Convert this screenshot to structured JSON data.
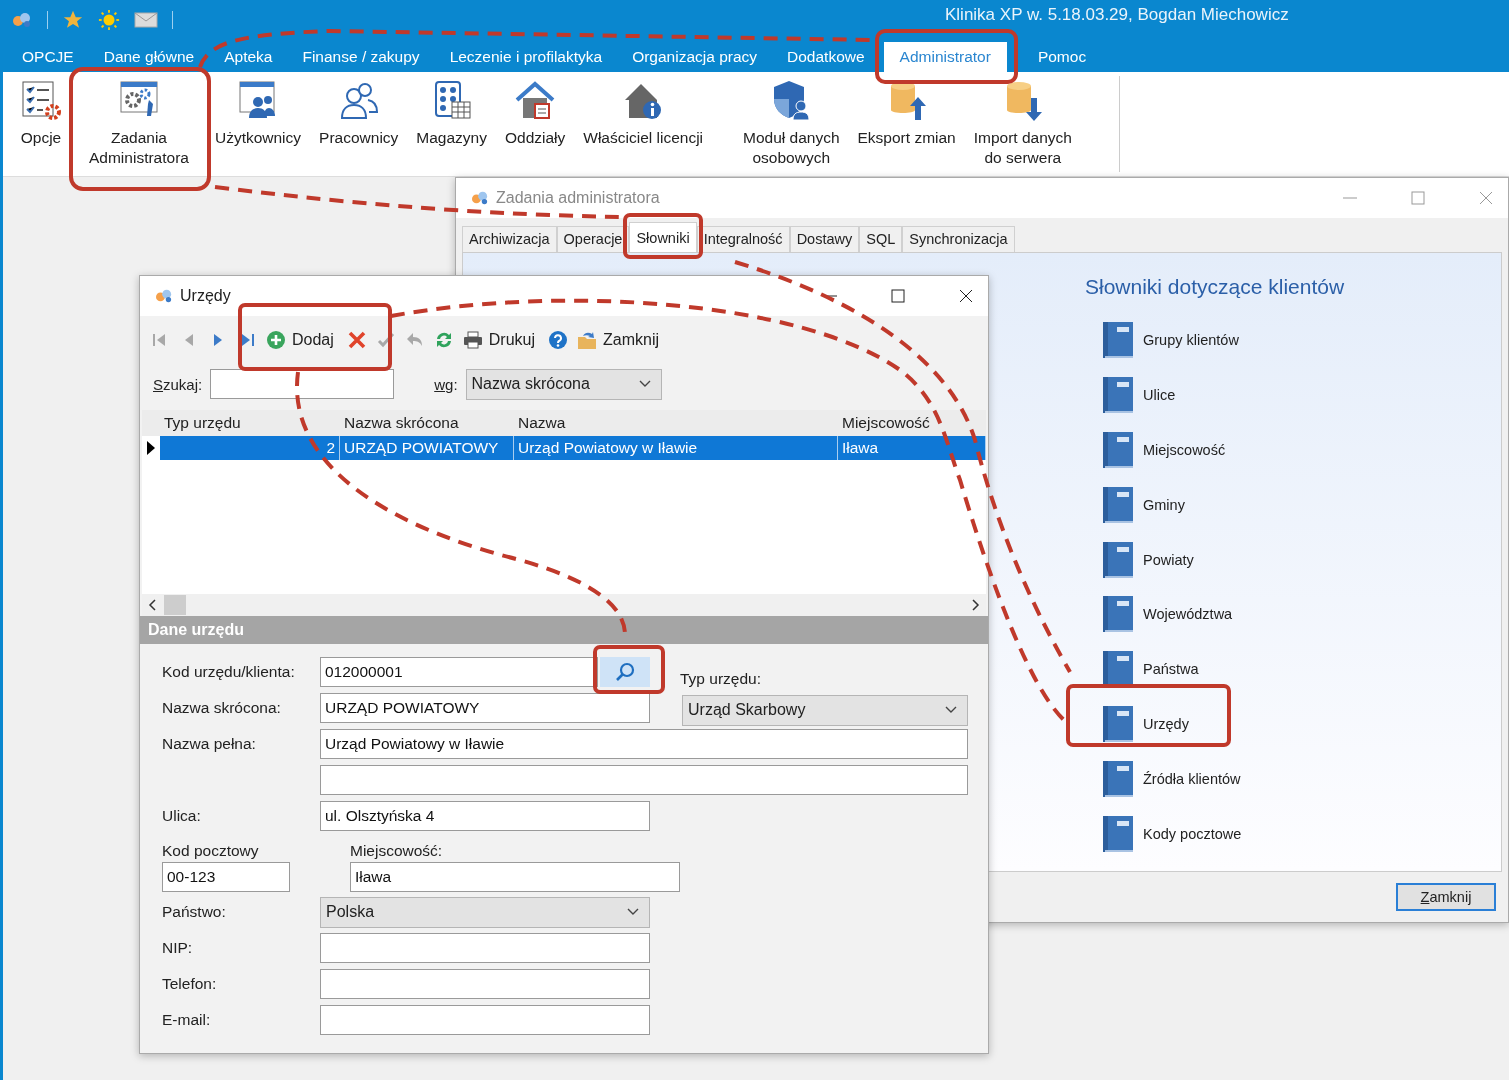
{
  "app": {
    "title": "Klinika XP w. 5.18.03.29, Bogdan Miechowicz",
    "menu": [
      {
        "label": "OPCJE",
        "selected": false
      },
      {
        "label": "Dane główne",
        "selected": false
      },
      {
        "label": "Apteka",
        "selected": false
      },
      {
        "label": "Finanse / zakupy",
        "selected": false
      },
      {
        "label": "Leczenie i profilaktyka",
        "selected": false
      },
      {
        "label": "Organizacja pracy",
        "selected": false
      },
      {
        "label": "Dodatkowe",
        "selected": false
      },
      {
        "label": "Administrator",
        "selected": true
      },
      {
        "label": "Pomoc",
        "selected": false
      }
    ],
    "ribbon": [
      {
        "lines": [
          "Opcje"
        ]
      },
      {
        "lines": [
          "Zadania",
          "Administratora"
        ]
      },
      {
        "lines": [
          "Użytkownicy"
        ]
      },
      {
        "lines": [
          "Pracownicy"
        ]
      },
      {
        "lines": [
          "Magazyny"
        ]
      },
      {
        "lines": [
          "Oddziały"
        ]
      },
      {
        "lines": [
          "Właściciel licencji"
        ]
      },
      {
        "lines": [
          "Moduł danych",
          "osobowych"
        ]
      },
      {
        "lines": [
          "Eksport zmian"
        ]
      },
      {
        "lines": [
          "Import danych",
          "do serwera"
        ]
      }
    ]
  },
  "tasks_window": {
    "title": "Zadania administratora",
    "tabs": [
      {
        "label": "Archiwizacja",
        "selected": false
      },
      {
        "label": "Operacje",
        "selected": false
      },
      {
        "label": "Słowniki",
        "selected": true
      },
      {
        "label": "Integralność",
        "selected": false
      },
      {
        "label": "Dostawy",
        "selected": false
      },
      {
        "label": "SQL",
        "selected": false
      },
      {
        "label": "Synchronizacja",
        "selected": false
      }
    ],
    "heading": "Słowniki dotyczące klientów",
    "items": [
      "Grupy klientów",
      "Ulice",
      "Miejscowość",
      "Gminy",
      "Powiaty",
      "Województwa",
      "Państwa",
      "Urzędy",
      "Źródła klientów",
      "Kody pocztowe"
    ],
    "close_button": "Zamknij"
  },
  "offices_window": {
    "title": "Urzędy",
    "toolbar": [
      {
        "kind": "first",
        "disabled": true
      },
      {
        "kind": "prev",
        "disabled": true
      },
      {
        "kind": "next",
        "disabled": false
      },
      {
        "kind": "last",
        "disabled": false
      },
      {
        "kind": "add",
        "label": "Dodaj",
        "disabled": false
      },
      {
        "kind": "delete",
        "disabled": false
      },
      {
        "kind": "confirm",
        "disabled": true
      },
      {
        "kind": "undo",
        "disabled": true
      },
      {
        "kind": "refresh",
        "disabled": false
      },
      {
        "kind": "print",
        "label": "Drukuj",
        "disabled": false
      },
      {
        "kind": "help",
        "disabled": false
      },
      {
        "kind": "close",
        "label": "Zamknij",
        "disabled": false
      }
    ],
    "search": {
      "label": "Szukaj:"
    },
    "sort": {
      "label": "wg:",
      "value": "Nazwa skrócona"
    },
    "table": {
      "columns": [
        "Typ urzędu",
        "Nazwa skrócona",
        "Nazwa",
        "Miejscowość"
      ],
      "rows": [
        {
          "cells": [
            "2",
            "URZĄD POWIATOWY",
            "Urząd Powiatowy w Iławie",
            "Iława"
          ],
          "selected": true
        }
      ]
    },
    "section": "Dane urzędu",
    "form": {
      "code": {
        "label": "Kod urzędu/klienta:",
        "value": "012000001"
      },
      "office_type": {
        "label": "Typ urzędu:",
        "value": "Urząd Skarbowy"
      },
      "short_name": {
        "label": "Nazwa skrócona:",
        "value": "URZĄD POWIATOWY"
      },
      "full_name": {
        "label": "Nazwa pełna:",
        "value": "Urząd Powiatowy w Iławie"
      },
      "street": {
        "label": "Ulica:",
        "value": "ul. Olsztyńska 4"
      },
      "postal_code": {
        "label": "Kod pocztowy",
        "value": "00-123"
      },
      "city": {
        "label": "Miejscowość:",
        "value": "Iława"
      },
      "country": {
        "label": "Państwo:",
        "value": "Polska"
      },
      "nip": {
        "label": "NIP:"
      },
      "phone": {
        "label": "Telefon:"
      },
      "email": {
        "label": "E-mail:"
      }
    }
  }
}
